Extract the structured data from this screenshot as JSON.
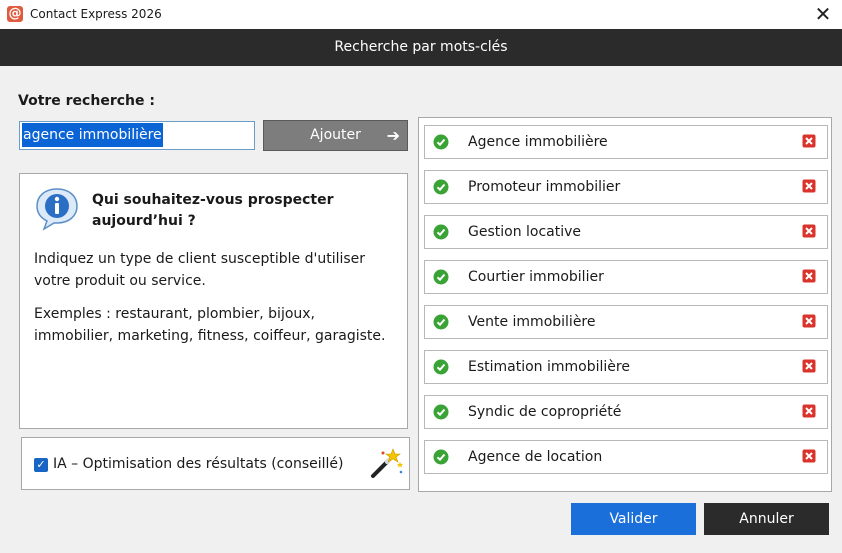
{
  "window": {
    "title": "Contact Express 2026",
    "close_glyph": "✕"
  },
  "header": {
    "title": "Recherche par mots-clés"
  },
  "search": {
    "label": "Votre recherche :",
    "value": "agence immobilière",
    "add_label": "Ajouter",
    "add_arrow": "➔"
  },
  "info": {
    "title": "Qui souhaitez-vous prospecter aujourd’hui ?",
    "text1": "Indiquez un type de client susceptible d'utiliser votre produit ou service.",
    "text2": "Exemples : restaurant, plombier, bijoux, immobilier, marketing, fitness, coiffeur, garagiste.",
    "icon": "info-icon"
  },
  "ia": {
    "label": "IA – Optimisation des résultats (conseillé)",
    "checked": true,
    "icon": "magic-wand-icon"
  },
  "results": {
    "items": [
      {
        "label": "Agence immobilière"
      },
      {
        "label": "Promoteur immobilier"
      },
      {
        "label": "Gestion locative"
      },
      {
        "label": "Courtier immobilier"
      },
      {
        "label": "Vente immobilière"
      },
      {
        "label": "Estimation immobilière"
      },
      {
        "label": "Syndic de copropriété"
      },
      {
        "label": "Agence de location"
      }
    ]
  },
  "footer": {
    "validate_label": "Valider",
    "cancel_label": "Annuler"
  },
  "colors": {
    "accent": "#1a6fdb",
    "header_bg": "#2b2b2b",
    "check_green": "#3aa335",
    "delete_red": "#d9332b"
  }
}
